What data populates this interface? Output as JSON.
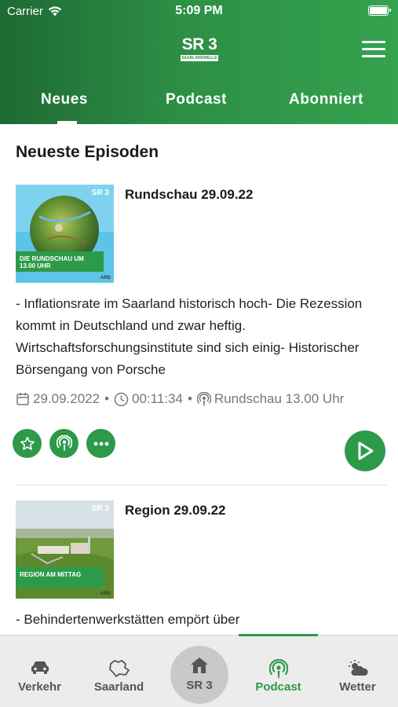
{
  "status_bar": {
    "carrier": "Carrier",
    "time": "5:09 PM"
  },
  "header": {
    "logo_main": "SR 3",
    "logo_sub": "SAARLANDWELLE",
    "tabs": [
      {
        "label": "Neues",
        "active": true
      },
      {
        "label": "Podcast",
        "active": false
      },
      {
        "label": "Abonniert",
        "active": false
      }
    ]
  },
  "main": {
    "section_title": "Neueste Episoden",
    "episodes": [
      {
        "title": "Rundschau 29.09.22",
        "cover_badge": "SR 3",
        "cover_label": "DIE RUNDSCHAU UM 13.00 UHR",
        "cover_brand": "ARD",
        "description": "- Inflationsrate im Saarland historisch hoch- Die Rezession kommt in Deutschland und zwar heftig. Wirtschaftsforschungsinstitute sind sich einig- Historischer Börsengang von Porsche",
        "date": "29.09.2022",
        "duration": "00:11:34",
        "podcast": "Rundschau 13.00 Uhr"
      },
      {
        "title": "Region 29.09.22",
        "cover_badge": "SR 3",
        "cover_label": "REGION AM MITTAG",
        "cover_brand": "ARD",
        "description": "- Behindertenwerkstätten empört über"
      }
    ],
    "separator": "•"
  },
  "bottom_nav": {
    "items": [
      {
        "label": "Verkehr",
        "icon": "car-icon"
      },
      {
        "label": "Saarland",
        "icon": "saarland-map-icon"
      },
      {
        "label": "SR 3",
        "icon": "home-icon"
      },
      {
        "label": "Podcast",
        "icon": "podcast-icon",
        "active": true
      },
      {
        "label": "Wetter",
        "icon": "weather-icon"
      }
    ]
  },
  "colors": {
    "brand_green": "#2d9a49",
    "header_dark": "#1e6a34",
    "meta_gray": "#777777"
  }
}
